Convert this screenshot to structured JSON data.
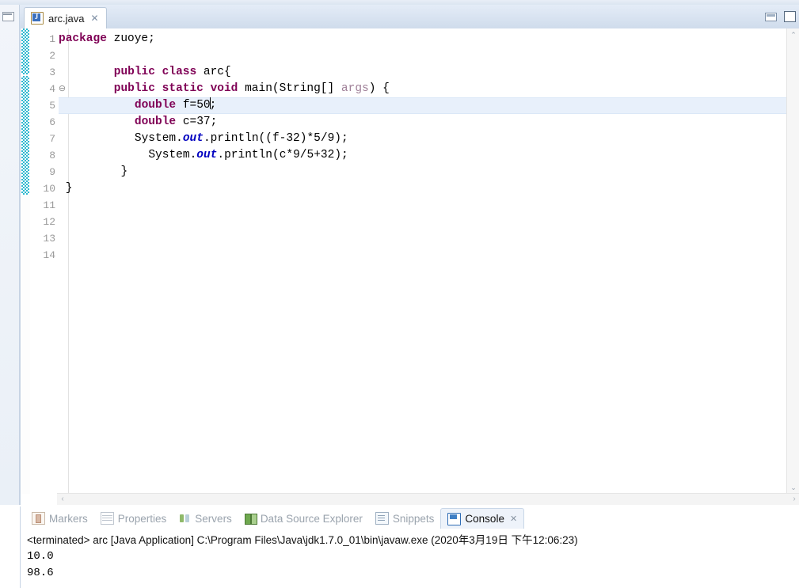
{
  "window": {
    "minimize_icon": "minimize-icon",
    "maximize_icon": "maximize-icon",
    "rail_icon": "restore-view-icon"
  },
  "editor": {
    "tab": {
      "label": "arc.java",
      "icon": "java-file-icon",
      "letter": "J",
      "close": "✕"
    },
    "scrollbar": {
      "up_arrow": "⌃",
      "down_arrow": "⌄",
      "left_arrow": "‹",
      "right_arrow": "›"
    },
    "fold_marker": "⊖",
    "line_numbers": [
      "1",
      "2",
      "3",
      "4",
      "5",
      "6",
      "7",
      "8",
      "9",
      "10",
      "11",
      "12",
      "13",
      "14"
    ],
    "highlighted_line": 5,
    "code_lines": [
      {
        "n": 1,
        "indent": 0,
        "tokens": [
          {
            "t": "package",
            "c": "kw"
          },
          {
            "t": " zuoye;",
            "c": "plain"
          }
        ]
      },
      {
        "n": 2,
        "indent": 0,
        "tokens": []
      },
      {
        "n": 3,
        "indent": 8,
        "tokens": [
          {
            "t": "public class",
            "c": "kw"
          },
          {
            "t": " arc{",
            "c": "plain"
          }
        ]
      },
      {
        "n": 4,
        "indent": 8,
        "tokens": [
          {
            "t": "public static void",
            "c": "kw"
          },
          {
            "t": " main(String[] ",
            "c": "plain"
          },
          {
            "t": "args",
            "c": "param"
          },
          {
            "t": ") {",
            "c": "plain"
          }
        ]
      },
      {
        "n": 5,
        "indent": 11,
        "tokens": [
          {
            "t": "double",
            "c": "kw"
          },
          {
            "t": " f=50",
            "c": "plain"
          },
          {
            "t": "|",
            "c": "caret"
          },
          {
            "t": ";",
            "c": "plain"
          }
        ]
      },
      {
        "n": 6,
        "indent": 11,
        "tokens": [
          {
            "t": "double",
            "c": "kw"
          },
          {
            "t": " c=37;",
            "c": "plain"
          }
        ]
      },
      {
        "n": 7,
        "indent": 11,
        "tokens": [
          {
            "t": "System.",
            "c": "plain"
          },
          {
            "t": "out",
            "c": "fld"
          },
          {
            "t": ".println((f-32)*5/9);",
            "c": "plain"
          }
        ]
      },
      {
        "n": 8,
        "indent": 13,
        "tokens": [
          {
            "t": "System.",
            "c": "plain"
          },
          {
            "t": "out",
            "c": "fld"
          },
          {
            "t": ".println(c*9/5+32);",
            "c": "plain"
          }
        ]
      },
      {
        "n": 9,
        "indent": 9,
        "tokens": [
          {
            "t": "}",
            "c": "plain"
          }
        ]
      },
      {
        "n": 10,
        "indent": 1,
        "tokens": [
          {
            "t": "}",
            "c": "plain"
          }
        ]
      }
    ]
  },
  "bottom_panel": {
    "tabs": [
      {
        "label": "Markers",
        "icon": "markers-icon",
        "active": false
      },
      {
        "label": "Properties",
        "icon": "properties-icon",
        "active": false
      },
      {
        "label": "Servers",
        "icon": "servers-icon",
        "active": false
      },
      {
        "label": "Data Source Explorer",
        "icon": "data-source-explorer-icon",
        "active": false
      },
      {
        "label": "Snippets",
        "icon": "snippets-icon",
        "active": false
      },
      {
        "label": "Console",
        "icon": "console-icon",
        "active": true,
        "close": "✕"
      }
    ],
    "console": {
      "terminated_line": "<terminated> arc [Java Application] C:\\Program Files\\Java\\jdk1.7.0_01\\bin\\javaw.exe (2020年3月19日 下午12:06:23)",
      "output": [
        "10.0",
        "98.6"
      ]
    }
  },
  "colors": {
    "keyword": "#7f0055",
    "field": "#0000c0",
    "parameter": "#a08098",
    "line_highlight": "#e8f0fb",
    "change_bar": "#2fb8cf",
    "tab_bar": "#cfdcec"
  }
}
